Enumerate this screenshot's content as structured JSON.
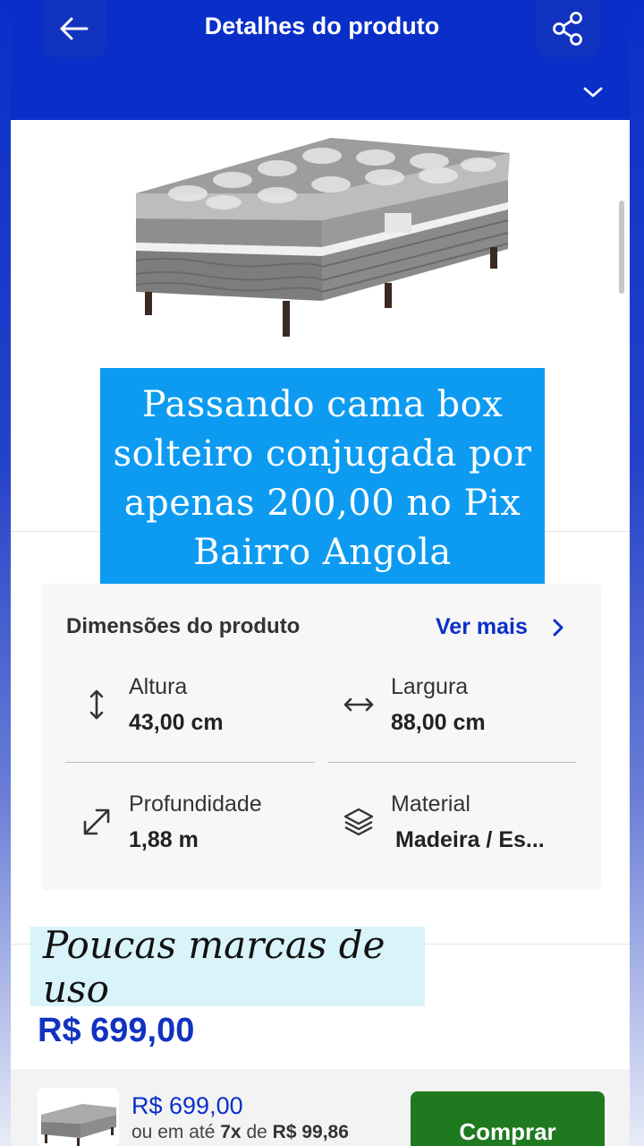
{
  "header": {
    "title": "Detalhes do produto",
    "back_icon": "arrow-left-icon",
    "share_icon": "share-icon",
    "expand_icon": "chevron-down-icon"
  },
  "promo": {
    "text": "Passando cama box solteiro conjugada por apenas 200,00 no Pix Bairro Angola"
  },
  "dimensions": {
    "title": "Dimensões do produto",
    "see_more": "Ver mais",
    "items": [
      {
        "label": "Altura",
        "value": "43,00 cm",
        "icon": "arrows-vertical-icon"
      },
      {
        "label": "Largura",
        "value": "88,00 cm",
        "icon": "arrows-horizontal-icon"
      },
      {
        "label": "Profundidade",
        "value": "1,88 m",
        "icon": "arrows-diagonal-icon"
      },
      {
        "label": "Material",
        "value": "Madeira / Es...",
        "icon": "layers-icon"
      }
    ]
  },
  "condition": {
    "text": "Poucas marcas de uso"
  },
  "price": {
    "main": "R$ 699,00"
  },
  "bottom_bar": {
    "price": "R$ 699,00",
    "installment_prefix": "ou em até",
    "installment_count": "7x",
    "installment_mid": "de",
    "installment_value": "R$ 99,86",
    "buy_label": "Comprar"
  },
  "colors": {
    "brand_blue": "#0a2fc9",
    "promo_blue": "#0d9bf2",
    "buy_green": "#1f7a1f",
    "condition_bg": "#d8f3fa"
  }
}
